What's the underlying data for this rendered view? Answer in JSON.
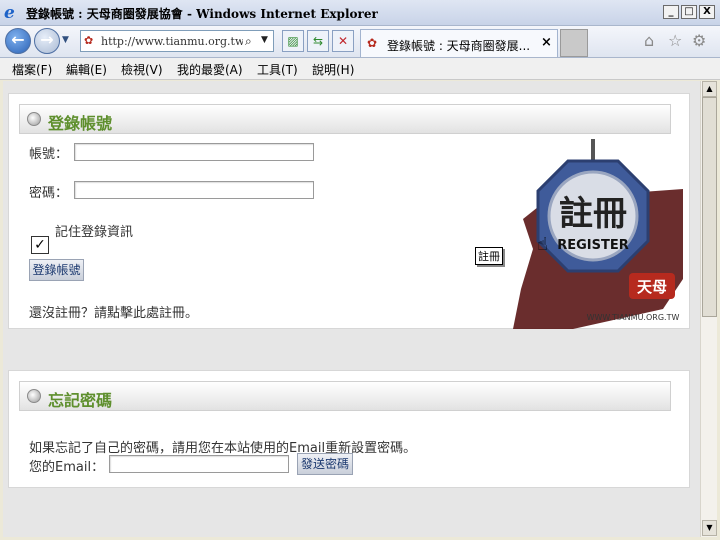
{
  "window": {
    "title": "登錄帳號 : 天母商圈發展協會 - Windows Internet Explorer",
    "minimize": "_",
    "maximize": "□",
    "close": "X"
  },
  "navbar": {
    "address": "http://www.tianmu.org.tw/use",
    "tab_label": "登錄帳號 : 天母商圈發展...",
    "tab_close": "×"
  },
  "menubar": [
    "檔案(F)",
    "編輯(E)",
    "檢視(V)",
    "我的最愛(A)",
    "工具(T)",
    "說明(H)"
  ],
  "login": {
    "title": "登錄帳號",
    "account_label": "帳號：",
    "password_label": "密碼：",
    "remember_label": "記住登錄資訊",
    "remember_checked": true,
    "login_button": "登錄帳號",
    "register_prompt": "還沒註冊？請點擊此處註冊。",
    "badge_text_main": "註冊",
    "badge_text_sub": "REGISTER",
    "badge_stamp": "天母",
    "badge_url": "WWW.TIANMU.ORG.TW",
    "tooltip": "註冊"
  },
  "forgot": {
    "title": "忘記密碼",
    "description": "如果忘記了自己的密碼，請用您在本站使用的Email重新設置密碼。",
    "email_label": "您的Email：",
    "send_button": "發送密碼"
  },
  "colors": {
    "section_title": "#5e8f2d",
    "button_text": "#1d3a70",
    "badge_blue": "#3f5b9a",
    "stamp_red": "#b62a1e"
  }
}
